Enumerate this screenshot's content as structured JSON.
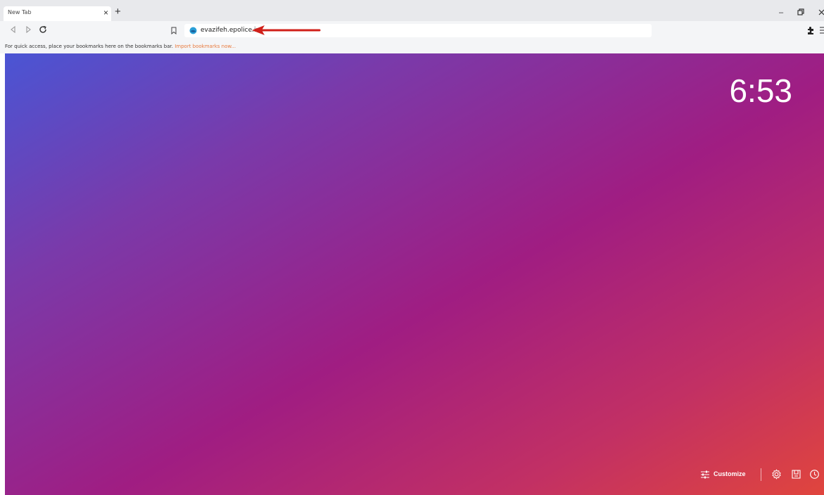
{
  "browser": {
    "tab": {
      "title": "New Tab"
    },
    "window_controls": {
      "minimize": "–",
      "restore": "⧉",
      "close": "✕"
    },
    "address_bar": {
      "url": "evazifeh.epolice.ir"
    },
    "bookmarks_bar": {
      "message": "For quick access, place your bookmarks here on the bookmarks bar.",
      "import_link": "Import bookmarks now..."
    }
  },
  "new_tab_page": {
    "clock": "6:53",
    "customize_label": "Customize",
    "icons": [
      "customize-sliders-icon",
      "settings-gear-icon",
      "bookmarks-icon",
      "history-icon"
    ]
  },
  "annotation": {
    "arrow_color": "#d0201a"
  },
  "colors": {
    "gradient_start": "#4a55d4",
    "gradient_mid": "#a01d82",
    "gradient_end": "#e0453d",
    "import_link": "#e87a3d"
  }
}
